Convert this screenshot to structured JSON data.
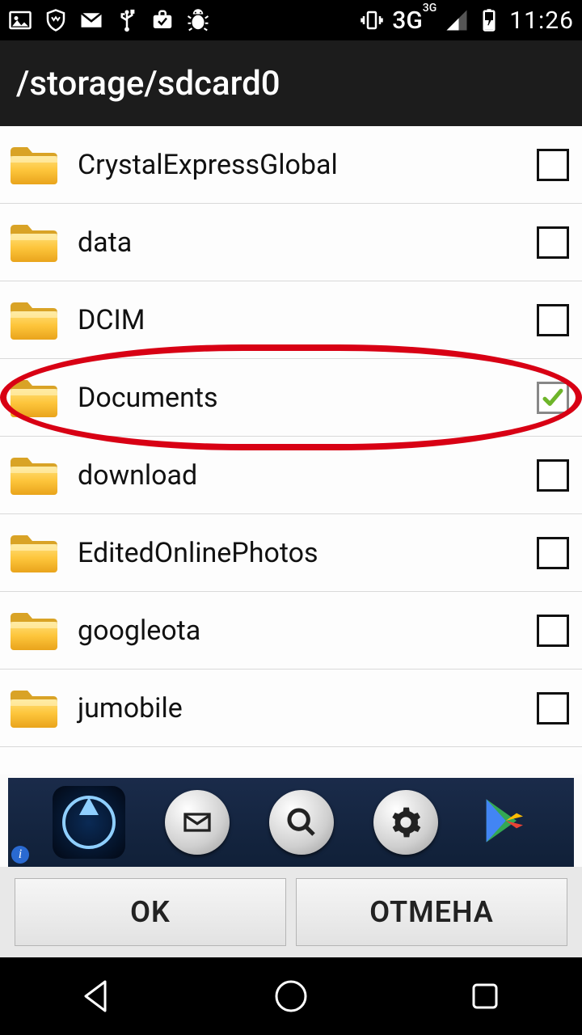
{
  "status": {
    "network_label": "3G",
    "network_sup": "3G",
    "time": "11:26"
  },
  "header": {
    "path": "/storage/sdcard0"
  },
  "folders": [
    {
      "name": "CrystalExpressGlobal",
      "checked": false,
      "highlight": false
    },
    {
      "name": "data",
      "checked": false,
      "highlight": false
    },
    {
      "name": "DCIM",
      "checked": false,
      "highlight": false
    },
    {
      "name": "Documents",
      "checked": true,
      "highlight": true
    },
    {
      "name": "download",
      "checked": false,
      "highlight": false
    },
    {
      "name": "EditedOnlinePhotos",
      "checked": false,
      "highlight": false
    },
    {
      "name": "googleota",
      "checked": false,
      "highlight": false
    },
    {
      "name": "jumobile",
      "checked": false,
      "highlight": false
    }
  ],
  "buttons": {
    "ok": "OK",
    "cancel": "ОТМЕНА"
  }
}
